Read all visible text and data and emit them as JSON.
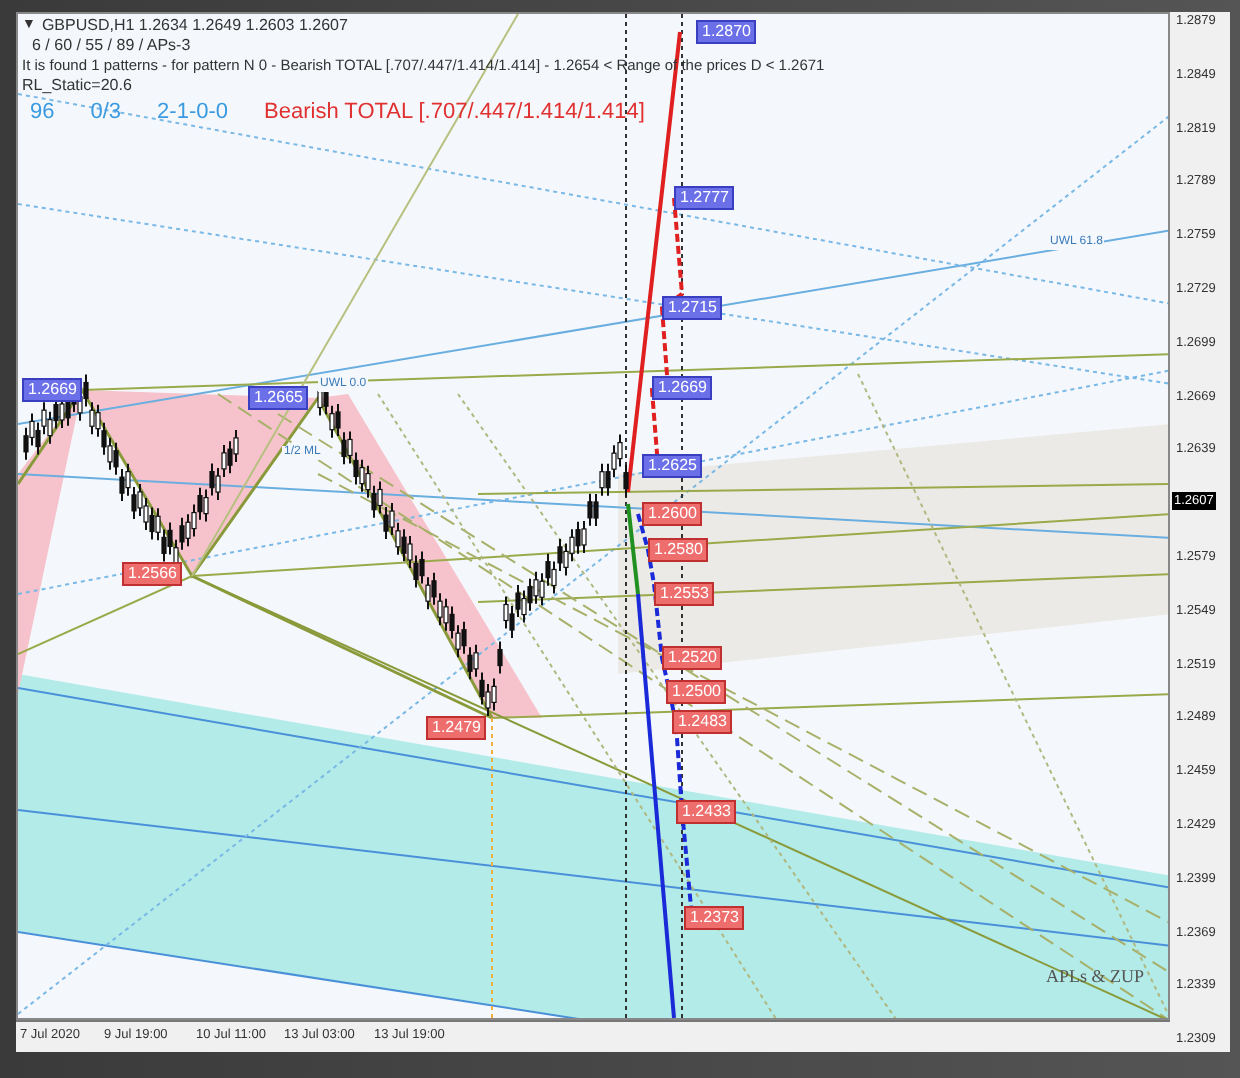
{
  "header": {
    "arrow": "▼",
    "symbol_line": "GBPUSD,H1  1.2634 1.2649 1.2603 1.2607",
    "settings_line": "6 / 60 / 55 / 89 / APs-3",
    "pattern_line": "It is found 1 patterns  -  for pattern N 0 - Bearish TOTAL [.707/.447/1.414/1.414] - 1.2654 < Range of the prices D < 1.2671",
    "static_line": "RL_Static=20.6",
    "status_values": [
      "96",
      "0/3",
      "2-1-0-0"
    ],
    "pattern_name": "Bearish TOTAL [.707/.447/1.414/1.414]"
  },
  "chart": {
    "price_labels": [
      {
        "text": "1.2870",
        "kind": "up"
      },
      {
        "text": "1.2777",
        "kind": "up"
      },
      {
        "text": "1.2715",
        "kind": "up"
      },
      {
        "text": "1.2669",
        "kind": "up"
      },
      {
        "text": "1.2625",
        "kind": "up"
      },
      {
        "text": "1.2669",
        "kind": "up"
      },
      {
        "text": "1.2665",
        "kind": "up"
      },
      {
        "text": "1.2600",
        "kind": "down"
      },
      {
        "text": "1.2580",
        "kind": "down"
      },
      {
        "text": "1.2553",
        "kind": "down"
      },
      {
        "text": "1.2520",
        "kind": "down"
      },
      {
        "text": "1.2500",
        "kind": "down"
      },
      {
        "text": "1.2483",
        "kind": "down"
      },
      {
        "text": "1.2433",
        "kind": "down"
      },
      {
        "text": "1.2373",
        "kind": "down"
      },
      {
        "text": "1.2566",
        "kind": "down"
      },
      {
        "text": "1.2479",
        "kind": "down"
      }
    ],
    "line_labels": [
      "UWL 61.8",
      "UWL 0.0",
      "1/2 ML"
    ],
    "signature": "APLs & ZUP",
    "price_axis": [
      "1.2879",
      "1.2849",
      "1.2819",
      "1.2789",
      "1.2759",
      "1.2729",
      "1.2699",
      "1.2669",
      "1.2639",
      "1.2579",
      "1.2549",
      "1.2519",
      "1.2489",
      "1.2459",
      "1.2429",
      "1.2399",
      "1.2369",
      "1.2339",
      "1.2309"
    ],
    "current_price": "1.2607",
    "time_axis": [
      "7 Jul 2020",
      "9 Jul 19:00",
      "10 Jul 11:00",
      "13 Jul 03:00",
      "13 Jul 19:00"
    ]
  }
}
